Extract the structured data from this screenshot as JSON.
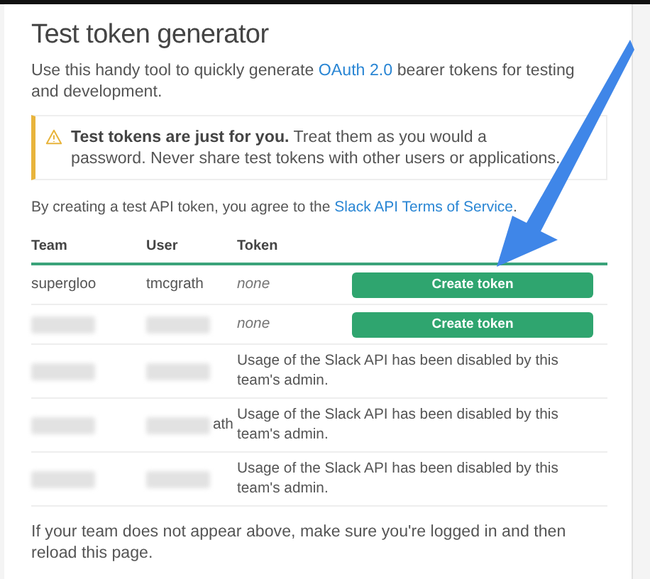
{
  "title": "Test token generator",
  "intro_link": "OAuth 2.0",
  "intro_before": "Use this handy tool to quickly generate ",
  "intro_after": " bearer tokens for testing and development.",
  "warning": {
    "bold": "Test tokens are just for you.",
    "text": " Treat them as you would a password. Never share test tokens with other users or applications."
  },
  "terms": {
    "before": "By creating a test API token, you agree to the ",
    "link": "Slack API Terms of Service",
    "after": "."
  },
  "table": {
    "columns": [
      "Team",
      "User",
      "Token"
    ],
    "rows": [
      {
        "kind": "token",
        "team": "supergloo",
        "user": "tmcgrath",
        "token": "none",
        "button": "Create token",
        "team_redacted": false,
        "user_redacted": false
      },
      {
        "kind": "token",
        "token": "none",
        "button": "Create token",
        "team_redacted": true,
        "user_redacted": true
      },
      {
        "kind": "disabled",
        "message": "Usage of the Slack API has been disabled by this team's admin.",
        "team_redacted": true,
        "user_redacted": true
      },
      {
        "kind": "disabled",
        "message": "Usage of the Slack API has been disabled by this team's admin.",
        "team_redacted": true,
        "user_redacted": true,
        "user_visible": "ath"
      },
      {
        "kind": "disabled",
        "message": "Usage of the Slack API has been disabled by this team's admin.",
        "team_redacted": true,
        "user_redacted": true
      }
    ]
  },
  "footer": "If your team does not appear above, make sure you're logged in and then reload this page."
}
